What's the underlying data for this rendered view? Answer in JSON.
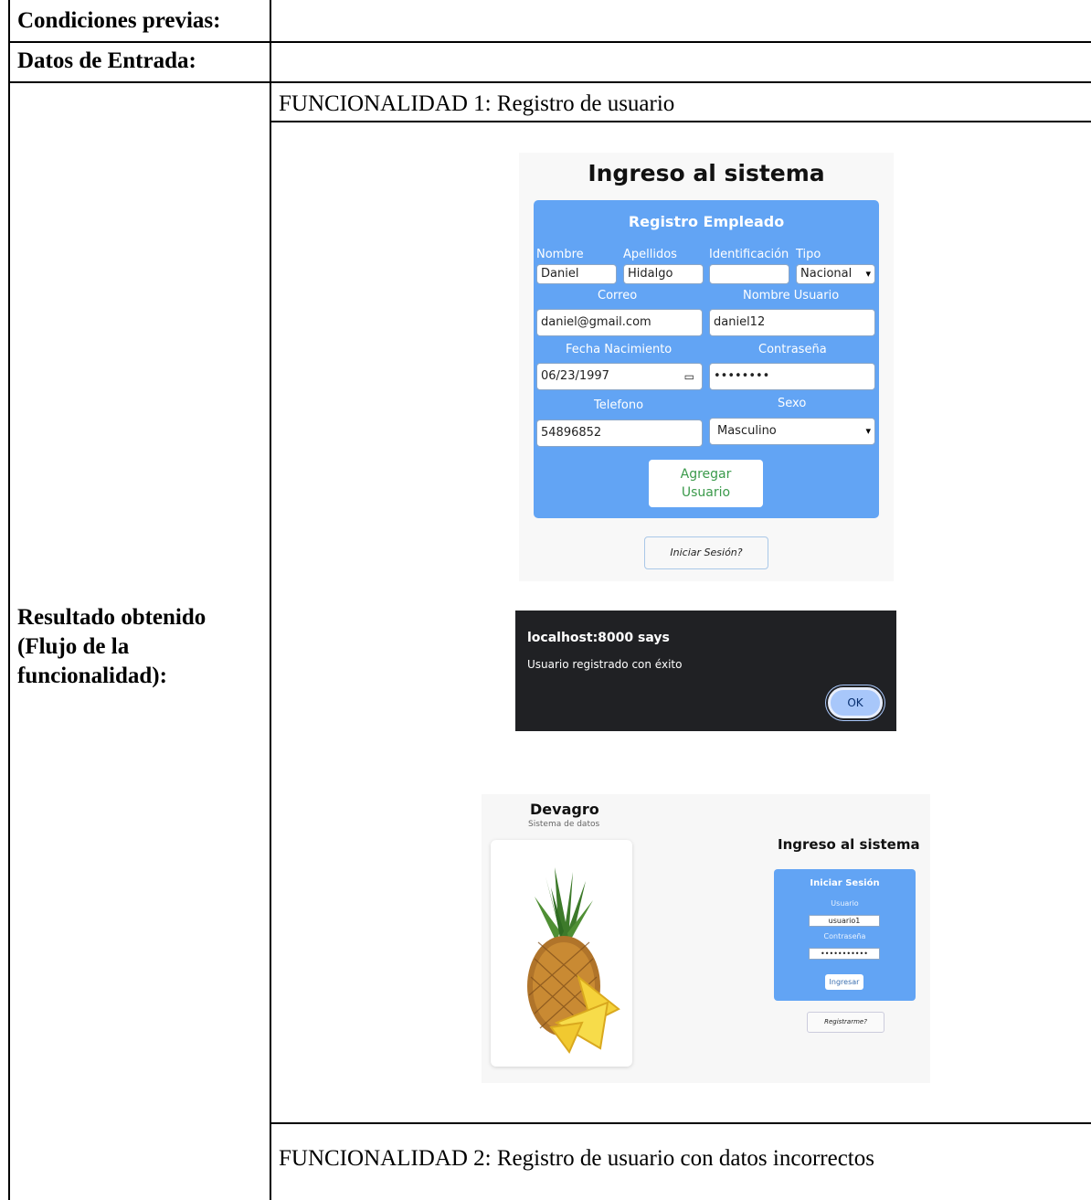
{
  "table": {
    "row1_label": "Condiciones previas:",
    "row2_label": "Datos de Entrada:",
    "row3_label": "Resultado obtenido (Flujo de la funcionalidad):",
    "func1_label": "FUNCIONALIDAD 1: Registro de usuario",
    "func2_label": "FUNCIONALIDAD 2: Registro de usuario con datos incorrectos"
  },
  "register_form": {
    "page_title": "Ingreso al sistema",
    "card_title": "Registro Empleado",
    "labels": {
      "nombre": "Nombre",
      "apellidos": "Apellidos",
      "identificacion": "Identificación",
      "tipo": "Tipo",
      "correo": "Correo",
      "nombre_usuario": "Nombre Usuario",
      "fecha_nacimiento": "Fecha Nacimiento",
      "contrasena": "Contraseña",
      "telefono": "Telefono",
      "sexo": "Sexo"
    },
    "values": {
      "nombre": "Daniel",
      "apellidos": "Hidalgo",
      "identificacion": "",
      "tipo": "Nacional",
      "correo": "daniel@gmail.com",
      "nombre_usuario": "daniel12",
      "fecha_nacimiento": "06/23/1997",
      "contrasena": "••••••••",
      "telefono": "54896852",
      "sexo": "Masculino"
    },
    "add_button_line1": "Agregar",
    "add_button_line2": "Usuario",
    "login_button": "Iniciar Sesión?"
  },
  "dialog": {
    "title": "localhost:8000 says",
    "message": "Usuario registrado con éxito",
    "ok_label": "OK"
  },
  "login_page": {
    "brand": "Devagro",
    "brand_subtitle": "Sistema de datos",
    "page_title": "Ingreso al sistema",
    "card_title": "Iniciar Sesión",
    "user_label": "Usuario",
    "user_value": "usuario1",
    "password_label": "Contraseña",
    "password_value": "•••••••••••",
    "submit_label": "Ingresar",
    "register_link": "Registrarme?"
  }
}
